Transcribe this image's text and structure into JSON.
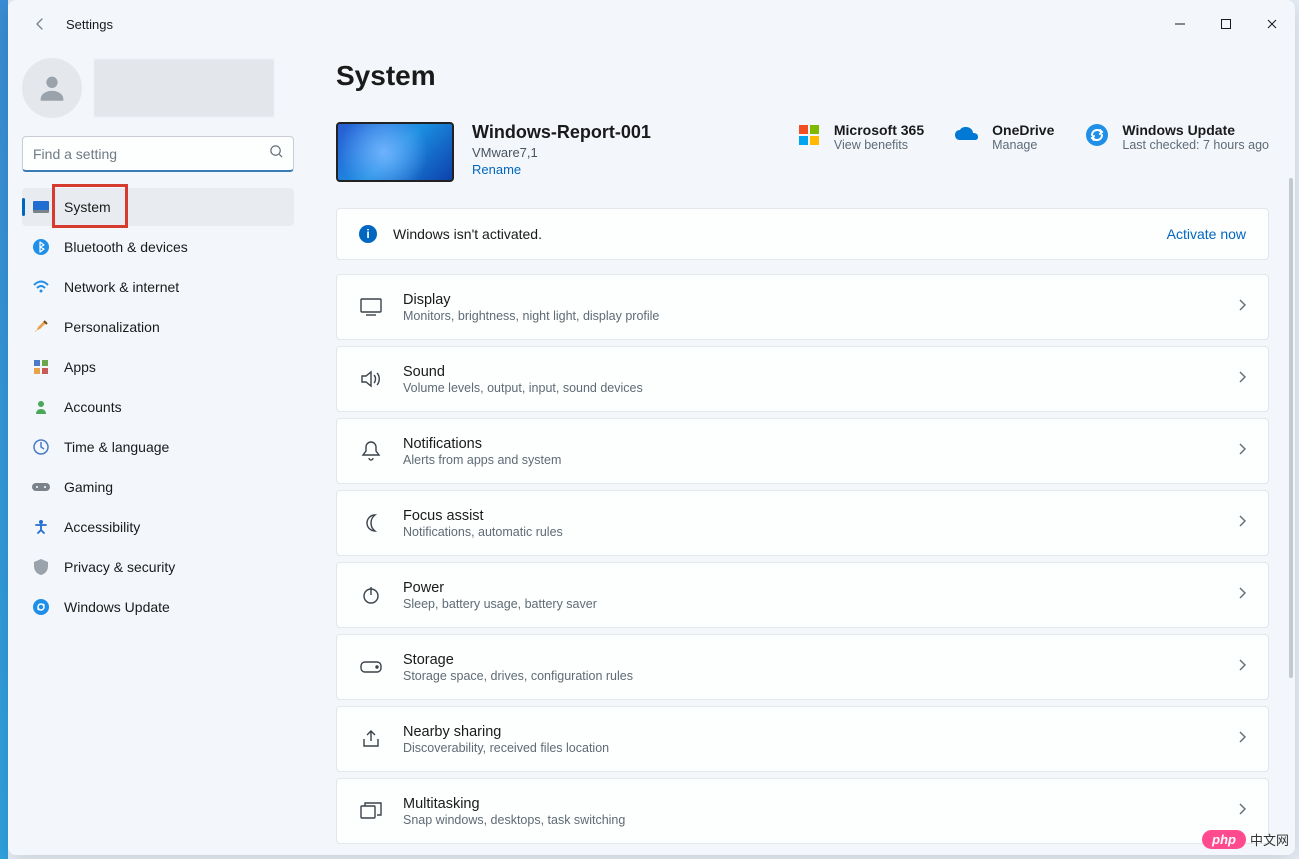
{
  "app_title": "Settings",
  "page_title": "System",
  "search": {
    "placeholder": "Find a setting"
  },
  "sidebar": {
    "items": [
      {
        "label": "System"
      },
      {
        "label": "Bluetooth & devices"
      },
      {
        "label": "Network & internet"
      },
      {
        "label": "Personalization"
      },
      {
        "label": "Apps"
      },
      {
        "label": "Accounts"
      },
      {
        "label": "Time & language"
      },
      {
        "label": "Gaming"
      },
      {
        "label": "Accessibility"
      },
      {
        "label": "Privacy & security"
      },
      {
        "label": "Windows Update"
      }
    ]
  },
  "device": {
    "name": "Windows-Report-001",
    "model": "VMware7,1",
    "rename": "Rename"
  },
  "top_cards": {
    "ms365": {
      "title": "Microsoft 365",
      "sub": "View benefits"
    },
    "onedrive": {
      "title": "OneDrive",
      "sub": "Manage"
    },
    "update": {
      "title": "Windows Update",
      "sub": "Last checked: 7 hours ago"
    }
  },
  "banner": {
    "message": "Windows isn't activated.",
    "action": "Activate now"
  },
  "settings": [
    {
      "title": "Display",
      "sub": "Monitors, brightness, night light, display profile",
      "icon": "display-icon"
    },
    {
      "title": "Sound",
      "sub": "Volume levels, output, input, sound devices",
      "icon": "sound-icon"
    },
    {
      "title": "Notifications",
      "sub": "Alerts from apps and system",
      "icon": "bell-icon"
    },
    {
      "title": "Focus assist",
      "sub": "Notifications, automatic rules",
      "icon": "moon-icon"
    },
    {
      "title": "Power",
      "sub": "Sleep, battery usage, battery saver",
      "icon": "power-icon"
    },
    {
      "title": "Storage",
      "sub": "Storage space, drives, configuration rules",
      "icon": "storage-icon"
    },
    {
      "title": "Nearby sharing",
      "sub": "Discoverability, received files location",
      "icon": "share-icon"
    },
    {
      "title": "Multitasking",
      "sub": "Snap windows, desktops, task switching",
      "icon": "multitask-icon"
    }
  ],
  "watermark": {
    "pill": "php",
    "text": "中文网"
  }
}
